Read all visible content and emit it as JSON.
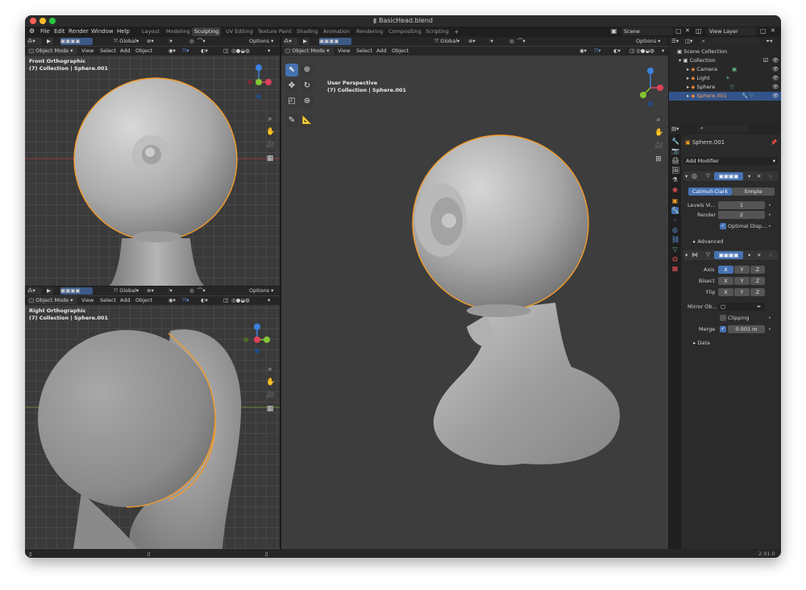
{
  "window": {
    "title": "BasicHead.blend"
  },
  "menu": {
    "items": [
      "File",
      "Edit",
      "Render",
      "Window",
      "Help"
    ]
  },
  "workspaces": {
    "tabs": [
      "Layout",
      "Modeling",
      "Sculpting",
      "UV Editing",
      "Texture Paint",
      "Shading",
      "Animation",
      "Rendering",
      "Compositing",
      "Scripting",
      "+"
    ],
    "active": "Sculpting"
  },
  "scene": {
    "name": "Scene",
    "view_layer": "View Layer"
  },
  "header": {
    "orientation": "Global",
    "options": "Options",
    "mode": "Object Mode",
    "view": "View",
    "select": "Select",
    "add": "Add",
    "object": "Object"
  },
  "viewports": {
    "front": {
      "label": "Front Orthographic",
      "collection": "(7) Collection | Sphere.001"
    },
    "right": {
      "label": "Right Orthographic",
      "collection": "(7) Collection | Sphere.001"
    },
    "persp": {
      "label": "User Perspective",
      "collection": "(7) Collection | Sphere.001"
    }
  },
  "outliner": {
    "root": "Scene Collection",
    "collection": "Collection",
    "items": [
      {
        "name": "Camera",
        "color": "#d97c3b"
      },
      {
        "name": "Light",
        "color": "#d97c3b"
      },
      {
        "name": "Sphere",
        "color": "#d97c3b"
      },
      {
        "name": "Sphere.001",
        "color": "#e8813a"
      }
    ],
    "selected": "Sphere.001"
  },
  "properties": {
    "object_name": "Sphere.001",
    "add_modifier": "Add Modifier",
    "subsurf": {
      "catmull": "Catmull-Clark",
      "simple": "Simple",
      "levels_label": "Levels Vi...",
      "levels_value": "1",
      "render_label": "Render",
      "render_value": "2",
      "optimal": "Optimal Disp...",
      "advanced": "Advanced"
    },
    "mirror": {
      "axis_label": "Axis",
      "bisect_label": "Bisect",
      "flip_label": "Flip",
      "x": "X",
      "y": "Y",
      "z": "Z",
      "mirror_object": "Mirror Ob...",
      "clipping": "Clipping",
      "merge_label": "Merge",
      "merge_value": "0.001 m",
      "data": "Data"
    }
  },
  "status": {
    "version": "2.91.0"
  },
  "colors": {
    "accent": "#4772b3",
    "selection": "#f39c2b",
    "axis_x": "#e0405a",
    "axis_y": "#85c433",
    "axis_z": "#3b82e0"
  }
}
